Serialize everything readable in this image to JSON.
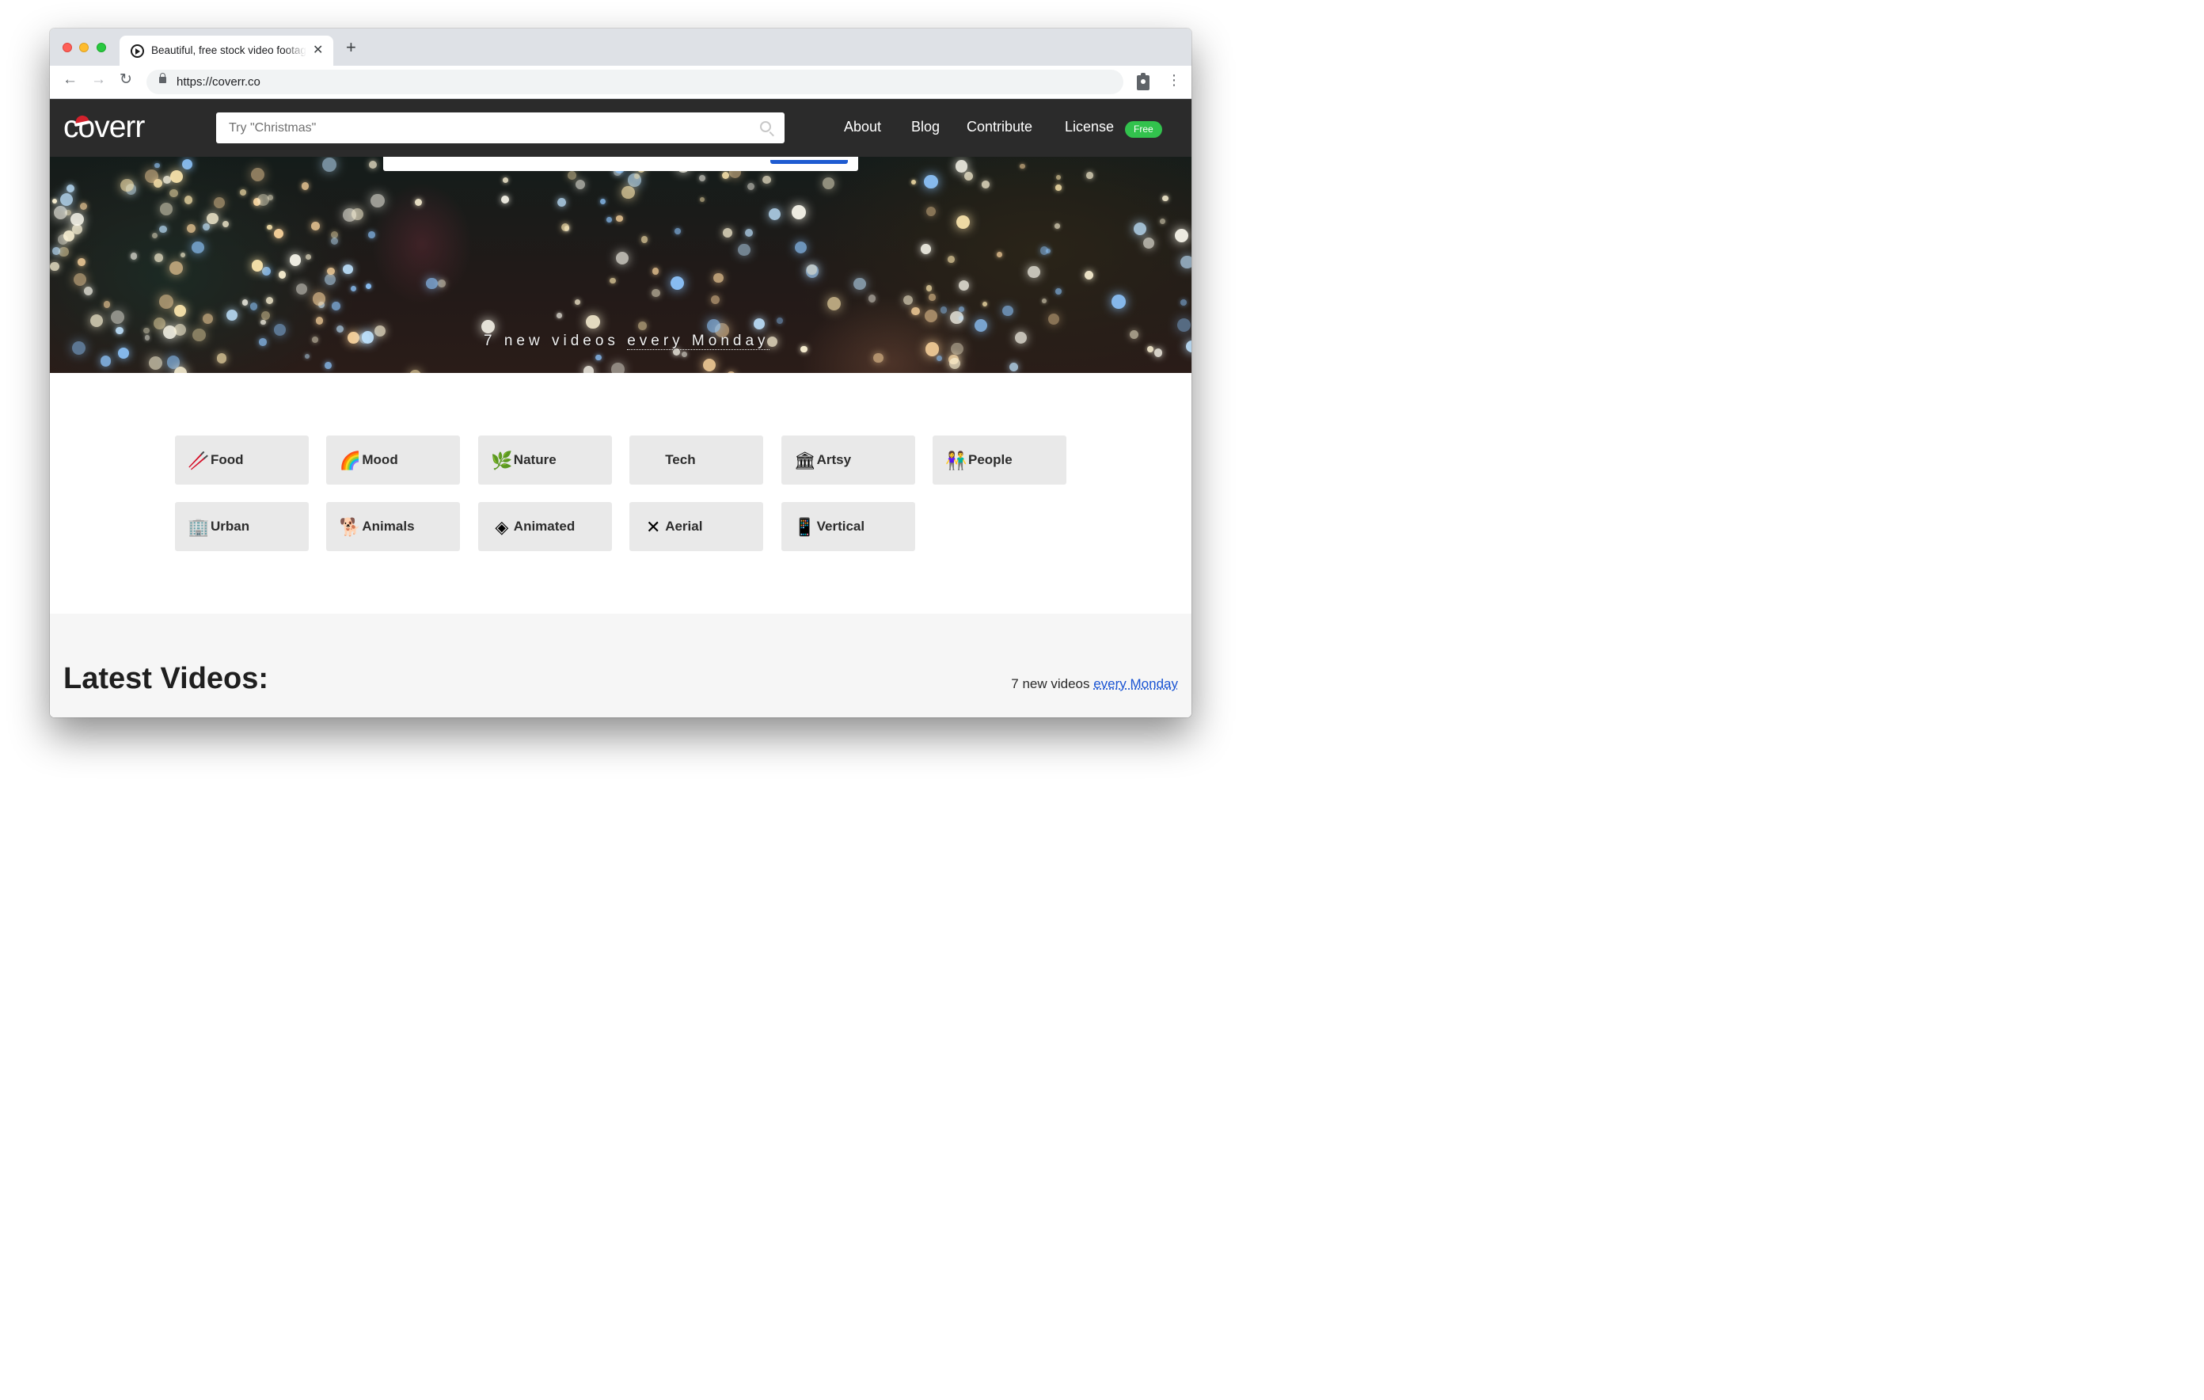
{
  "browser": {
    "tab": {
      "title": "Beautiful, free stock video footage",
      "close_symbol": "✕"
    },
    "new_tab_symbol": "+",
    "toolbar": {
      "back_symbol": "←",
      "forward_symbol": "→",
      "reload_symbol": "↻",
      "url": "https://coverr.co",
      "menu_symbol": "⋮"
    }
  },
  "header": {
    "logo": "coverr",
    "search_placeholder": "Try \"Christmas\"",
    "nav": {
      "about": "About",
      "blog": "Blog",
      "contribute": "Contribute",
      "license": "License"
    },
    "license_badge": "Free"
  },
  "hero": {
    "tagline_prefix": "7 new videos ",
    "tagline_link": "every Monday"
  },
  "categories": [
    {
      "label": "Food",
      "icon": "food-icon",
      "glyph": "🥢"
    },
    {
      "label": "Mood",
      "icon": "rainbow-icon",
      "glyph": "🌈"
    },
    {
      "label": "Nature",
      "icon": "leaf-icon",
      "glyph": "🌿"
    },
    {
      "label": "Tech",
      "icon": "apple-icon",
      "glyph": ""
    },
    {
      "label": "Artsy",
      "icon": "column-icon",
      "glyph": "🏛"
    },
    {
      "label": "People",
      "icon": "people-icon",
      "glyph": "👫"
    },
    {
      "label": "Urban",
      "icon": "buildings-icon",
      "glyph": "🏢"
    },
    {
      "label": "Animals",
      "icon": "dog-icon",
      "glyph": "🐕"
    },
    {
      "label": "Animated",
      "icon": "layers-icon",
      "glyph": "◈"
    },
    {
      "label": "Aerial",
      "icon": "drone-icon",
      "glyph": "✕"
    },
    {
      "label": "Vertical",
      "icon": "phone-icon",
      "glyph": "📱"
    }
  ],
  "latest": {
    "title": "Latest Videos:",
    "subtitle_prefix": "7 new videos ",
    "subtitle_link": "every Monday"
  },
  "colors": {
    "header_bg": "#2b2b2b",
    "free_badge": "#32c24d",
    "link": "#1a54d3",
    "category_bg": "#e9e9e9"
  }
}
